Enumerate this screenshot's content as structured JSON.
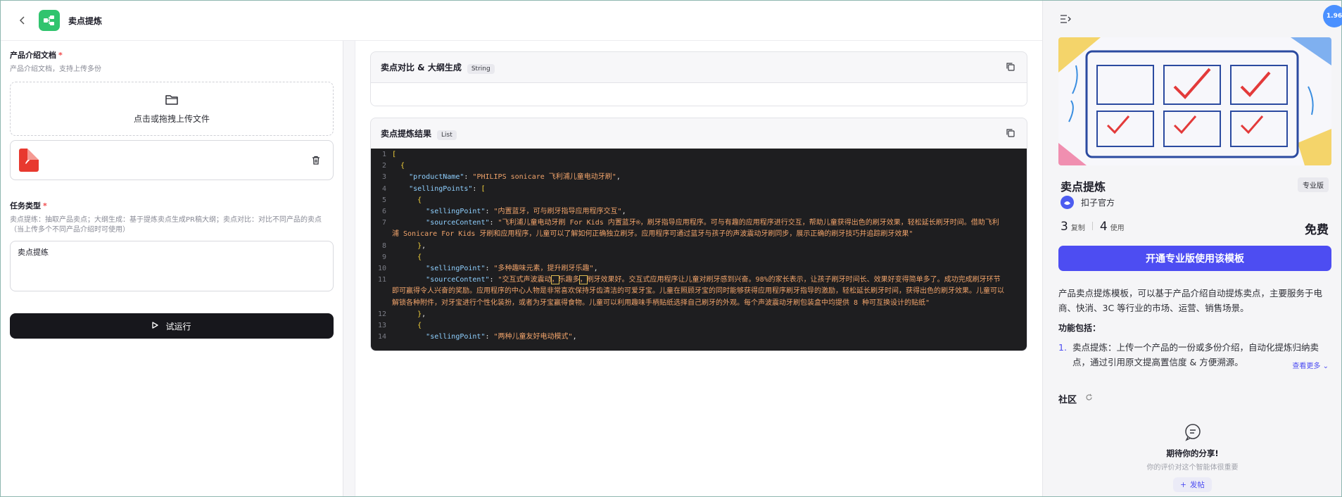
{
  "header": {
    "title": "卖点提炼"
  },
  "left": {
    "doc_label": "产品介绍文档",
    "doc_required": "*",
    "doc_hint": "产品介绍文档，支持上传多份",
    "upload_text": "点击或拖拽上传文件",
    "file_icon_text": "⬣",
    "task_label": "任务类型",
    "task_required": "*",
    "task_hint": "卖点提练：抽取产品卖点；大纲生成：基于提炼卖点生成PR稿大纲；卖点对比：对比不同产品的卖点（当上传多个不同产品介绍时可使用）",
    "task_value": "卖点提练",
    "run_label": "试运行"
  },
  "outputs": [
    {
      "title": "卖点对比 & 大纲生成",
      "type": "String"
    },
    {
      "title": "卖点提炼结果",
      "type": "List"
    }
  ],
  "code_lines": [
    {
      "n": "1",
      "html": "<span class='p'>[</span>"
    },
    {
      "n": "2",
      "html": "  <span class='p'>{</span>"
    },
    {
      "n": "3",
      "html": "    <span class='k'>\"productName\"</span>: <span class='s'>\"PHILIPS sonicare 飞利浦儿童电动牙刷\"</span>,"
    },
    {
      "n": "4",
      "html": "    <span class='k'>\"sellingPoints\"</span>: <span class='p'>[</span>"
    },
    {
      "n": "5",
      "html": "      <span class='p'>{</span>"
    },
    {
      "n": "6",
      "html": "        <span class='k'>\"sellingPoint\"</span>: <span class='s'>\"内置蓝牙，可与刷牙指导应用程序交互\"</span>,"
    },
    {
      "n": "7",
      "html": "        <span class='k'>\"sourceContent\"</span>: <span class='s'>\"飞利浦儿童电动牙刷 For Kids 内置蓝牙®，刷牙指导应用程序。可与有趣的应用程序进行交互，帮助儿童获得出色的刷牙效果，轻松延长刷牙时间。借助飞利浦 Sonicare For Kids 牙刷和应用程序，儿童可以了解如何正确独立刷牙。应用程序可通过蓝牙与孩子的声波震动牙刷同步，展示正确的刷牙技巧并追踪刷牙效果\"</span>"
    },
    {
      "n": "8",
      "html": "      <span class='p'>}</span>,"
    },
    {
      "n": "9",
      "html": "      <span class='p'>{</span>"
    },
    {
      "n": "10",
      "html": "        <span class='k'>\"sellingPoint\"</span>: <span class='s'>\"多种趣味元素，提升刷牙乐趣\"</span>,"
    },
    {
      "n": "11",
      "html": "        <span class='k'>\"sourceContent\"</span>: <span class='s'>\"交互式声波震动<span class='hl'>，</span>乐趣多<span class='hl'>，</span>刷牙效果好。交互式应用程序让儿童对刷牙感到兴奋。98%的家长表示，让孩子刷牙时间长、效果好变得简单多了。成功完成刷牙环节即可赢得令人兴奋的奖励。应用程序的中心人物是非常喜欢保持牙齿清洁的可爱牙宝。儿童在照顾牙宝的同时能够获得应用程序刷牙指导的激励，轻松延长刷牙时间，获得出色的刷牙效果。儿童可以解锁各种附件，对牙宝进行个性化装扮，或者为牙宝赢得食物。儿童可以利用趣味手柄贴纸选择自己刷牙的外观。每个声波震动牙刷包装盒中均提供 8 种可互换设计的贴纸\"</span>"
    },
    {
      "n": "12",
      "html": "      <span class='p'>}</span>,"
    },
    {
      "n": "13",
      "html": "      <span class='p'>{</span>"
    },
    {
      "n": "14",
      "html": "        <span class='k'>\"sellingPoint\"</span>: <span class='s'>\"两种儿童友好电动模式\"</span>,"
    }
  ],
  "right": {
    "badge": "1.96",
    "template_name": "卖点提炼",
    "edition": "专业版",
    "author": "扣子官方",
    "copies": "3",
    "copies_label": "复制",
    "uses": "4",
    "uses_label": "使用",
    "price": "免费",
    "cta": "开通专业版使用该模板",
    "description": "产品卖点提炼模板，可以基于产品介绍自动提炼卖点，主要服务于电商、快消、3C 等行业的市场、运营、销售场景。",
    "features_heading": "功能包括：",
    "feature_1_num": "1.",
    "feature_1": "卖点提炼：上传一个产品的一份或多份介绍，自动化提炼归纳卖点，通过引用原文提高置信度 & 方便溯源。",
    "more": "查看更多",
    "community": "社区",
    "empty_title": "期待你的分享!",
    "empty_sub": "你的评价对这个智能体很重要",
    "post": "发帖"
  }
}
